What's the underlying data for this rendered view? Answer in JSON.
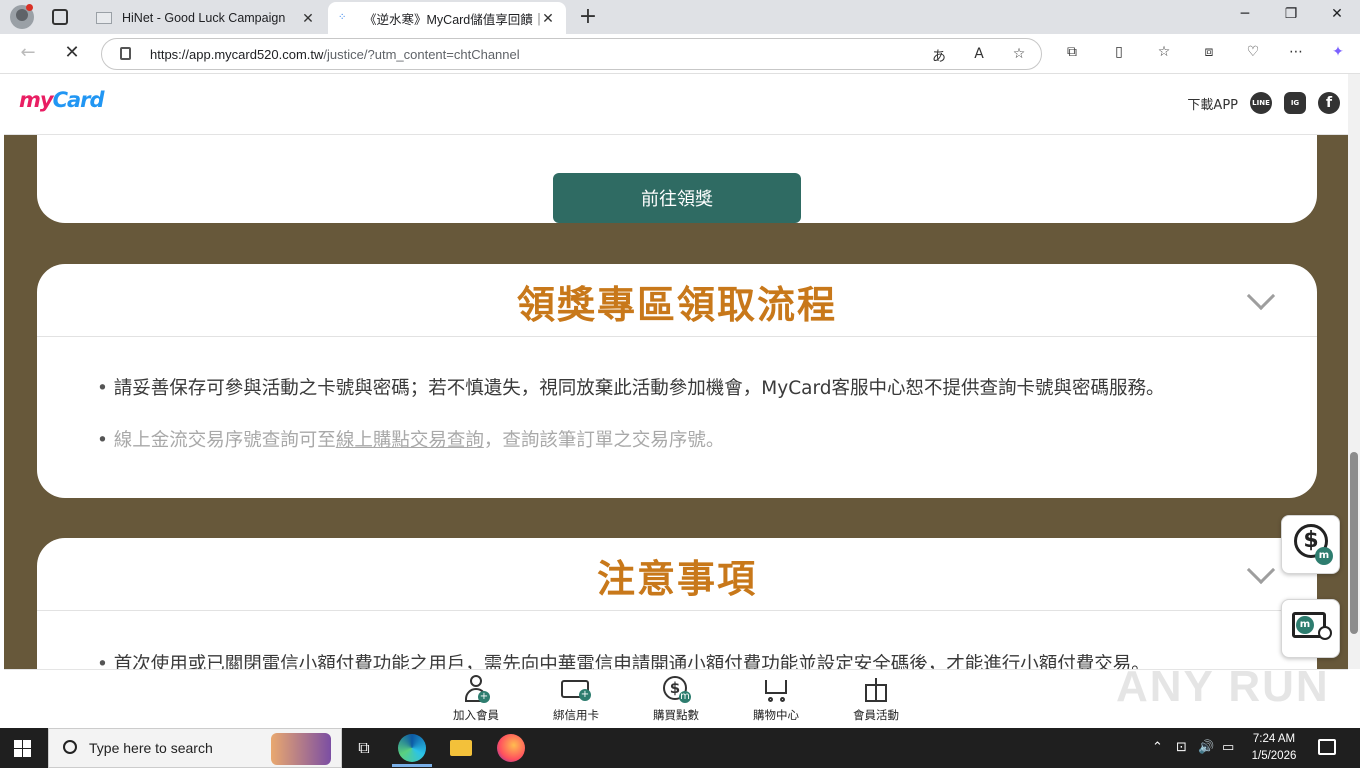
{
  "browser": {
    "tabs": [
      {
        "title": "HiNet - Good Luck Campaign",
        "active": false
      },
      {
        "title": "《逆水寒》MyCard儲值享回饋｜My",
        "active": true
      }
    ],
    "address": {
      "host": "https://app.mycard520.com.tw",
      "path": "/justice/?utm_content=chtChannel"
    }
  },
  "header": {
    "logo_text_m": "my",
    "logo_text_c": "Card",
    "download_app": "下載APP",
    "social": [
      "LINE",
      "IG",
      "f"
    ]
  },
  "card1": {
    "button_label": "前往領獎"
  },
  "card2": {
    "title": "領獎專區領取流程",
    "bullets": {
      "b1": "請妥善保存可參與活動之卡號與密碼；若不慎遺失，視同放棄此活動參加機會，MyCard客服中心恕不提供查詢卡號與密碼服務。",
      "b2_pre": "線上金流交易序號查詢可至",
      "b2_link": "線上購點交易查詢",
      "b2_post": "，查詢該筆訂單之交易序號。"
    }
  },
  "card3": {
    "title": "注意事項",
    "bullet1": "首次使用或已關閉電信小額付費功能之用戶，需先向中華電信申請開通小額付費功能並設定安全碼後，才能進行小額付費交易。"
  },
  "bottom_nav": [
    {
      "label": "加入會員",
      "icon": "user-add-icon"
    },
    {
      "label": "綁信用卡",
      "icon": "credit-card-icon"
    },
    {
      "label": "購買點數",
      "icon": "dollar-coin-icon"
    },
    {
      "label": "購物中心",
      "icon": "shopping-cart-icon"
    },
    {
      "label": "會員活動",
      "icon": "gift-icon"
    }
  ],
  "watermark": "ANY RUN",
  "taskbar": {
    "search_placeholder": "Type here to search",
    "time": "7:24 AM",
    "date": "1/5/2026"
  },
  "colors": {
    "page_bg": "#67583a",
    "accent_title": "#c8781a",
    "button": "#2f6b63"
  }
}
